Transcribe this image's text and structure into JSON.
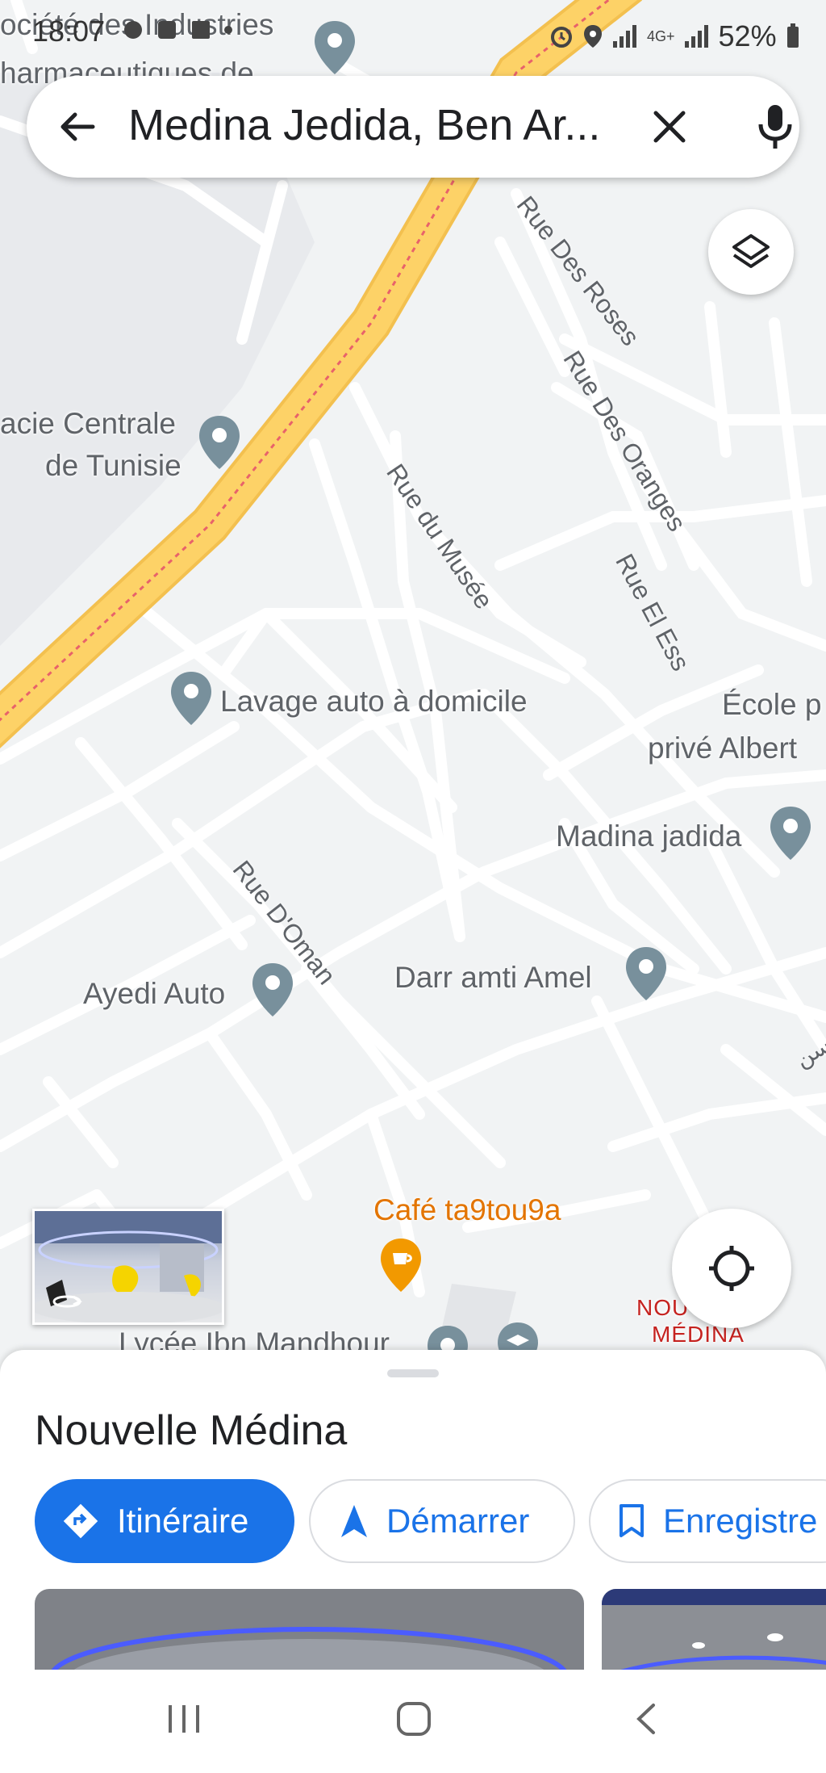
{
  "status_bar": {
    "time": "18:07",
    "battery": "52%",
    "network": "4G+"
  },
  "search": {
    "query": "Medina Jedida, Ben Ar..."
  },
  "map": {
    "pois": [
      {
        "name": "ociété des Industries"
      },
      {
        "name": "harmaceutiques de"
      },
      {
        "name": "acie Centrale"
      },
      {
        "name": "de Tunisie"
      },
      {
        "name": "Lavage auto à domicile"
      },
      {
        "name": "École p"
      },
      {
        "name": "privé Albert"
      },
      {
        "name": "Madina jadida"
      },
      {
        "name": "Ayedi Auto"
      },
      {
        "name": "Darr amti Amel"
      },
      {
        "name": "Café ta9tou9a"
      },
      {
        "name": "Lycée Ibn Mandhour"
      }
    ],
    "streets": [
      {
        "name": "Rue Des Roses"
      },
      {
        "name": "Rue Des Oranges"
      },
      {
        "name": "Rue du Musée"
      },
      {
        "name": "Rue El Ess"
      },
      {
        "name": "Rue D'Oman"
      }
    ],
    "district_label": [
      "NOU",
      "MÉDINA"
    ],
    "arabic_label": "وسن",
    "colors": {
      "background": "#f1f3f4",
      "road": "#ffffff",
      "highway": "#fdd267",
      "poi_pin": "#78909c",
      "cafe_pin": "#f29900",
      "district": "#c5221f"
    }
  },
  "place_sheet": {
    "title": "Nouvelle Médina",
    "actions": [
      {
        "label": "Itinéraire",
        "icon": "directions-icon"
      },
      {
        "label": "Démarrer",
        "icon": "navigation-arrow-icon"
      },
      {
        "label": "Enregistre",
        "icon": "bookmark-icon"
      }
    ]
  },
  "icons": [
    "back-arrow-icon",
    "close-icon",
    "mic-icon",
    "layers-icon",
    "my-location-icon",
    "street-view-icon"
  ],
  "accent_color": "#1a73e8"
}
